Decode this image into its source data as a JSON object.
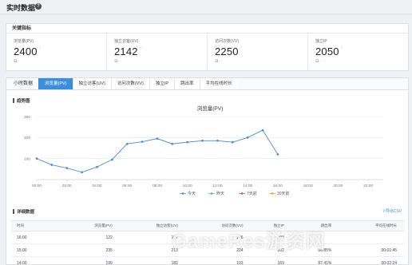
{
  "header": {
    "title": "实时数据",
    "help_icon": "help-icon",
    "help_glyph": "?"
  },
  "kpi": {
    "title": "关键指标",
    "items": [
      {
        "label": "浏览量(PV)",
        "value": "2400",
        "unit": "日-"
      },
      {
        "label": "独立访客(UV)",
        "value": "2142",
        "unit": "日-"
      },
      {
        "label": "访问次数(VV)",
        "value": "2250",
        "unit": "日-"
      },
      {
        "label": "独立IP",
        "value": "2050",
        "unit": "日-"
      }
    ]
  },
  "tabs": {
    "title": "小时数据",
    "items": [
      "浏览量(PV)",
      "独立访客(UV)",
      "访问次数(VV)",
      "独立IP",
      "跳出率",
      "平均在线时长"
    ],
    "active_index": 0
  },
  "trend_section": {
    "title": "趋势图"
  },
  "chart_data": {
    "type": "line",
    "title": "浏览量(PV)",
    "categories": [
      "00:00",
      "01:00",
      "02:00",
      "03:00",
      "04:00",
      "05:00",
      "06:00",
      "07:00",
      "08:00",
      "09:00",
      "10:00",
      "11:00",
      "12:00",
      "13:00",
      "14:00",
      "15:00",
      "16:00",
      "17:00",
      "18:00",
      "19:00",
      "20:00",
      "21:00",
      "22:00",
      "23:00"
    ],
    "tick_labels": [
      "00:00",
      "02:00",
      "04:00",
      "06:00",
      "08:00",
      "10:00",
      "12:00",
      "14:00",
      "16:00",
      "18:00",
      "20:00",
      "22:00"
    ],
    "yticks": [
      100,
      200,
      300
    ],
    "ylim": [
      0,
      300
    ],
    "series": [
      {
        "name": "今天",
        "color": "#4a90d9",
        "values": [
          100,
          70,
          55,
          35,
          60,
          95,
          170,
          180,
          195,
          170,
          178,
          185,
          185,
          178,
          200,
          235,
          120
        ]
      }
    ],
    "legend": [
      {
        "name": "今天",
        "color": "#4a90d9"
      },
      {
        "name": "昨天",
        "color": "#59c36a"
      },
      {
        "name": "7天前",
        "color": "#e0533f"
      },
      {
        "name": "30天前",
        "color": "#f0a030"
      }
    ],
    "legend_position": "bottom",
    "grid": true
  },
  "detail": {
    "title": "详细数据",
    "export_label": "导出CSV",
    "columns": [
      "时间",
      "浏览量(PV)",
      "独立访客(UV)",
      "访问次数(VV)",
      "独立IP",
      "跳出率",
      "平均在线时长"
    ],
    "rows": [
      [
        "16:00",
        "122",
        "107",
        "106",
        "103",
        "",
        ""
      ],
      [
        "15:00",
        "235",
        "213",
        "224",
        "202",
        "86.85%",
        "00:01:45"
      ],
      [
        "14:00",
        "199",
        "182",
        "193",
        "169",
        "87.41%",
        "00:02:24"
      ]
    ]
  },
  "watermark": "GameRes游资网"
}
